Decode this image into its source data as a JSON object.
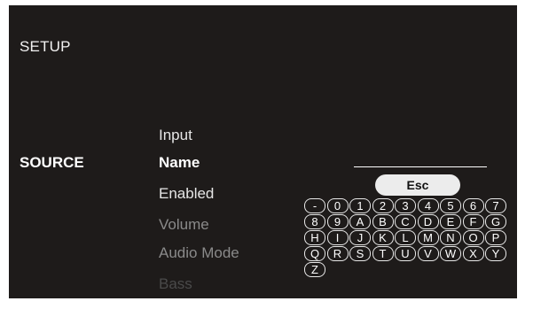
{
  "setup_title": "SETUP",
  "section_label": "SOURCE",
  "menu": {
    "items": [
      {
        "label": "Input",
        "state": "normal"
      },
      {
        "label": "Name",
        "state": "selected"
      },
      {
        "label": "Enabled",
        "state": "normal"
      },
      {
        "label": "Volume",
        "state": "dim1"
      },
      {
        "label": "Audio Mode",
        "state": "dim1"
      },
      {
        "label": "Bass",
        "state": "dim2"
      }
    ]
  },
  "name_field": {
    "value": ""
  },
  "keyboard": {
    "esc_label": "Esc",
    "rows": [
      [
        "-",
        "0",
        "1",
        "2",
        "3",
        "4",
        "5",
        "6",
        "7"
      ],
      [
        "8",
        "9",
        "A",
        "B",
        "C",
        "D",
        "E",
        "F",
        "G"
      ],
      [
        "H",
        "I",
        "J",
        "K",
        "L",
        "M",
        "N",
        "O",
        "P"
      ],
      [
        "Q",
        "R",
        "S",
        "T",
        "U",
        "V",
        "W",
        "X",
        "Y"
      ],
      [
        "Z"
      ]
    ]
  },
  "colors": {
    "background": "#1e1b1a",
    "text": "#ffffff",
    "dim_text": "#8a8a8a",
    "faint_text": "#4a4a4a",
    "esc_bg": "#ececec"
  }
}
